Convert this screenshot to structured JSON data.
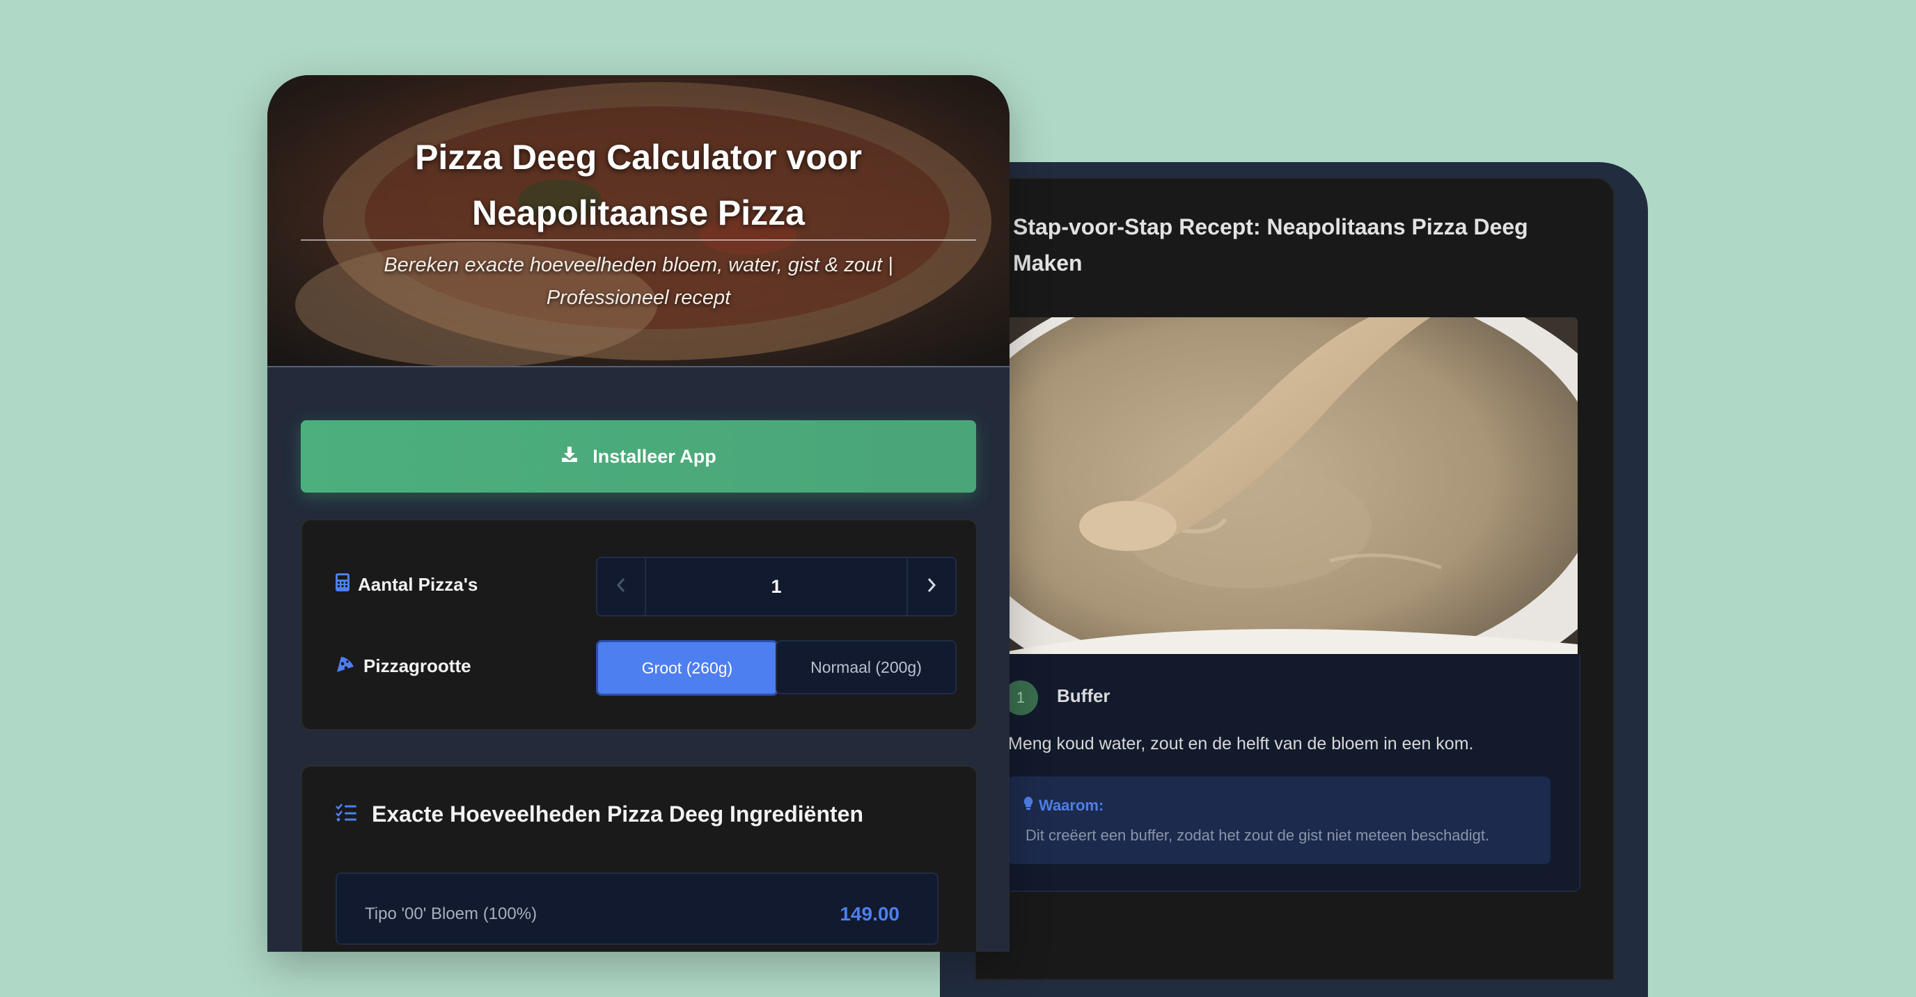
{
  "hero": {
    "title_line1": "Pizza Deeg Calculator voor",
    "title_line2": "Neapolitaanse Pizza",
    "subtitle_line1": "Bereken exacte hoeveelheden bloem, water, gist & zout |",
    "subtitle_line2": "Professioneel recept"
  },
  "install": {
    "label": "Installeer App",
    "icon": "download-icon"
  },
  "calculator": {
    "pizzas_label": "Aantal Pizza's",
    "pizzas_icon": "calculator-icon",
    "pizzas_value": "1",
    "size_label": "Pizzagrootte",
    "size_icon": "pizza-slice-icon",
    "size_options": [
      "Groot (260g)",
      "Normaal (200g)"
    ],
    "size_selected": "Groot (260g)"
  },
  "ingredients": {
    "title": "Exacte Hoeveelheden Pizza Deeg Ingrediënten",
    "icon": "list-check-icon",
    "first_row_name": "Tipo '00' Bloem (100%)",
    "first_row_amount": "149.00"
  },
  "recipe": {
    "title_line1": "Stap-voor-Stap Recept: Neapolitaans Pizza Deeg",
    "title_line2": "Maken",
    "step": {
      "number": "1",
      "title": "Buffer",
      "description": "Meng koud water, zout en de helft van de bloem in een kom.",
      "why_label": "Waarom:",
      "why_text": "Dit creëert een buffer, zodat het zout de gist niet meteen beschadigt."
    }
  },
  "colors": {
    "background": "#b0d8c6",
    "accent_blue": "#4e7ff0",
    "install_green": "#4caf7d"
  }
}
